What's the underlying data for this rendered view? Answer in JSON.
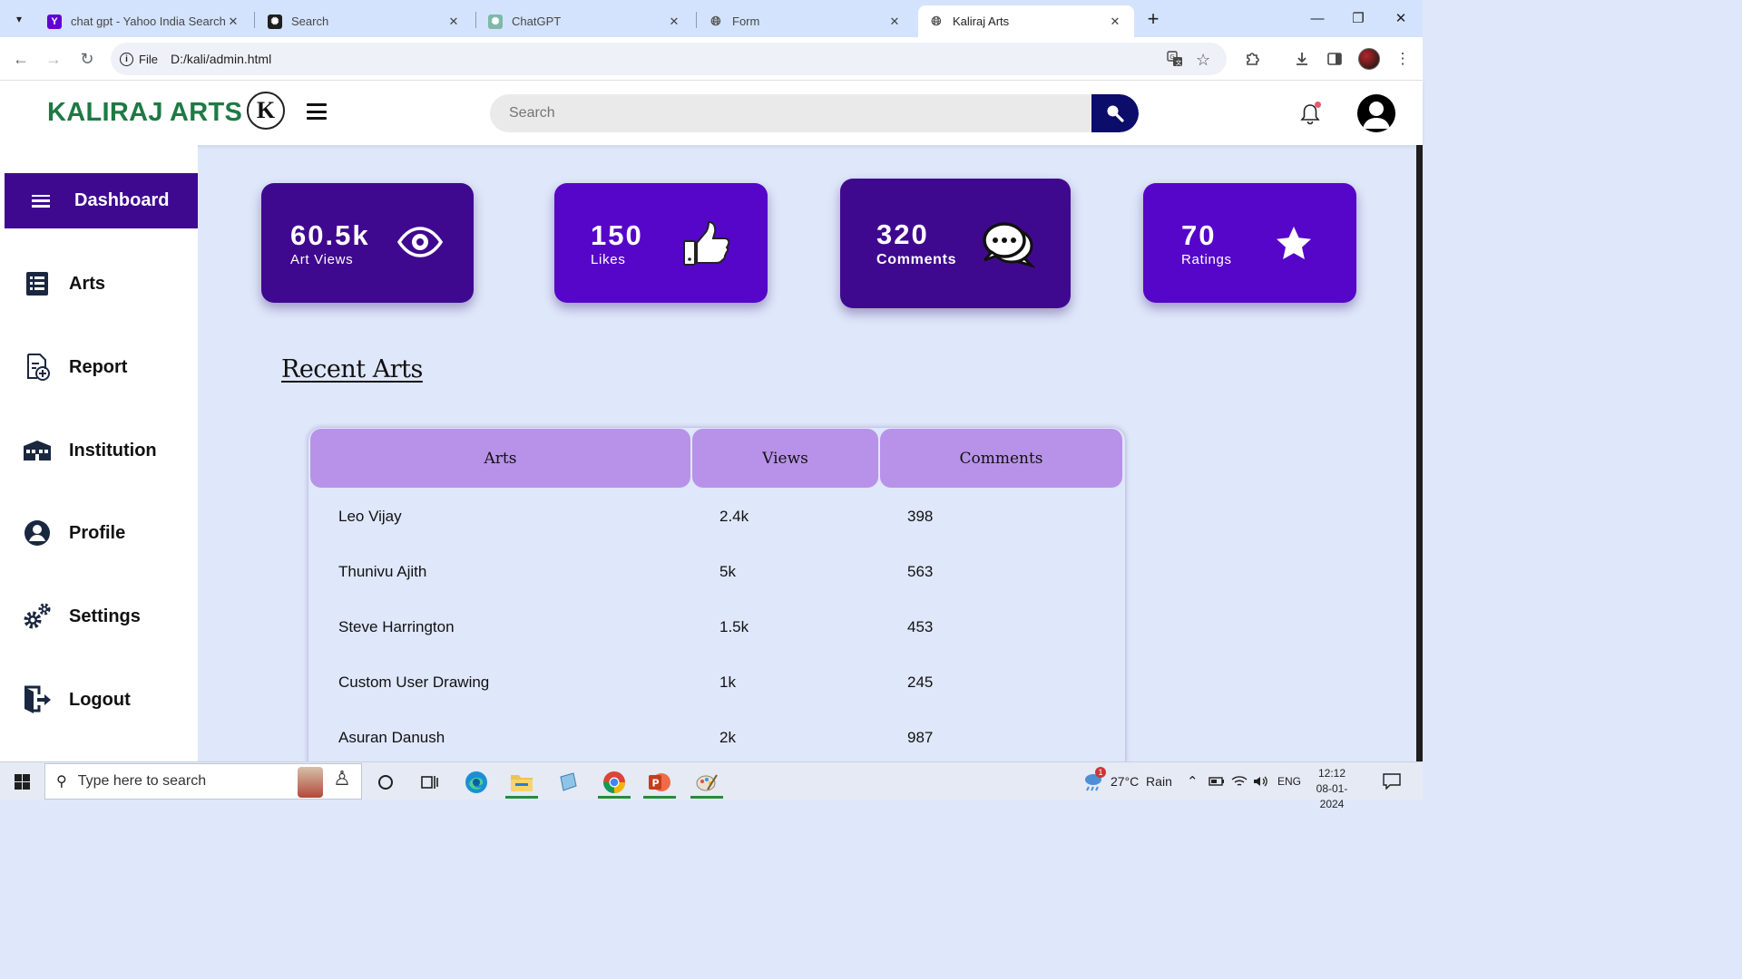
{
  "browser": {
    "tabs": [
      {
        "title": "chat gpt - Yahoo India Search R",
        "favicon": "yahoo-icon",
        "active": false
      },
      {
        "title": "Search",
        "favicon": "chatgpt-icon",
        "active": false
      },
      {
        "title": "ChatGPT",
        "favicon": "chatgpt-icon",
        "active": false
      },
      {
        "title": "Form",
        "favicon": "globe-icon",
        "active": false
      },
      {
        "title": "Kaliraj Arts",
        "favicon": "globe-icon",
        "active": true
      }
    ],
    "site_chip": "File",
    "url": "D:/kali/admin.html"
  },
  "header": {
    "brand": "KALIRAJ ARTS",
    "logo_letter": "K",
    "search_placeholder": "Search",
    "brand_color": "#1d7a44",
    "search_button_color": "#0c0c6b"
  },
  "sidebar": {
    "active": {
      "label": "Dashboard",
      "icon": "menu-icon"
    },
    "items": [
      {
        "label": "Arts",
        "icon": "document-list-icon"
      },
      {
        "label": "Report",
        "icon": "report-add-icon"
      },
      {
        "label": "Institution",
        "icon": "building-icon"
      },
      {
        "label": "Profile",
        "icon": "user-circle-icon"
      },
      {
        "label": "Settings",
        "icon": "gears-icon"
      },
      {
        "label": "Logout",
        "icon": "logout-icon"
      }
    ],
    "active_color": "#3f098f"
  },
  "stats": [
    {
      "value": "60.5k",
      "label": "Art Views",
      "icon": "eye-icon",
      "color": "#3f098f"
    },
    {
      "value": "150",
      "label": "Likes",
      "icon": "thumbs-up-icon",
      "color": "#5606c9"
    },
    {
      "value": "320",
      "label": "Comments",
      "icon": "chat-bubbles-icon",
      "color": "#3f098f"
    },
    {
      "value": "70",
      "label": "Ratings",
      "icon": "star-icon",
      "color": "#5606c9"
    }
  ],
  "recent": {
    "title": "Recent Arts",
    "columns": [
      "Arts",
      "Views",
      "Comments"
    ],
    "rows": [
      {
        "art": "Leo Vijay",
        "views": "2.4k",
        "comments": "398"
      },
      {
        "art": "Thunivu Ajith",
        "views": "5k",
        "comments": "563"
      },
      {
        "art": "Steve Harrington",
        "views": "1.5k",
        "comments": "453"
      },
      {
        "art": "Custom User Drawing",
        "views": "1k",
        "comments": "245"
      },
      {
        "art": "Asuran Danush",
        "views": "2k",
        "comments": "987"
      }
    ],
    "header_color": "#b892e8"
  },
  "taskbar": {
    "search_placeholder": "Type here to search",
    "weather": "27°C  Rain",
    "weather_badge": "1",
    "language": "ENG",
    "time": "12:12",
    "date": "08-01-2024"
  }
}
